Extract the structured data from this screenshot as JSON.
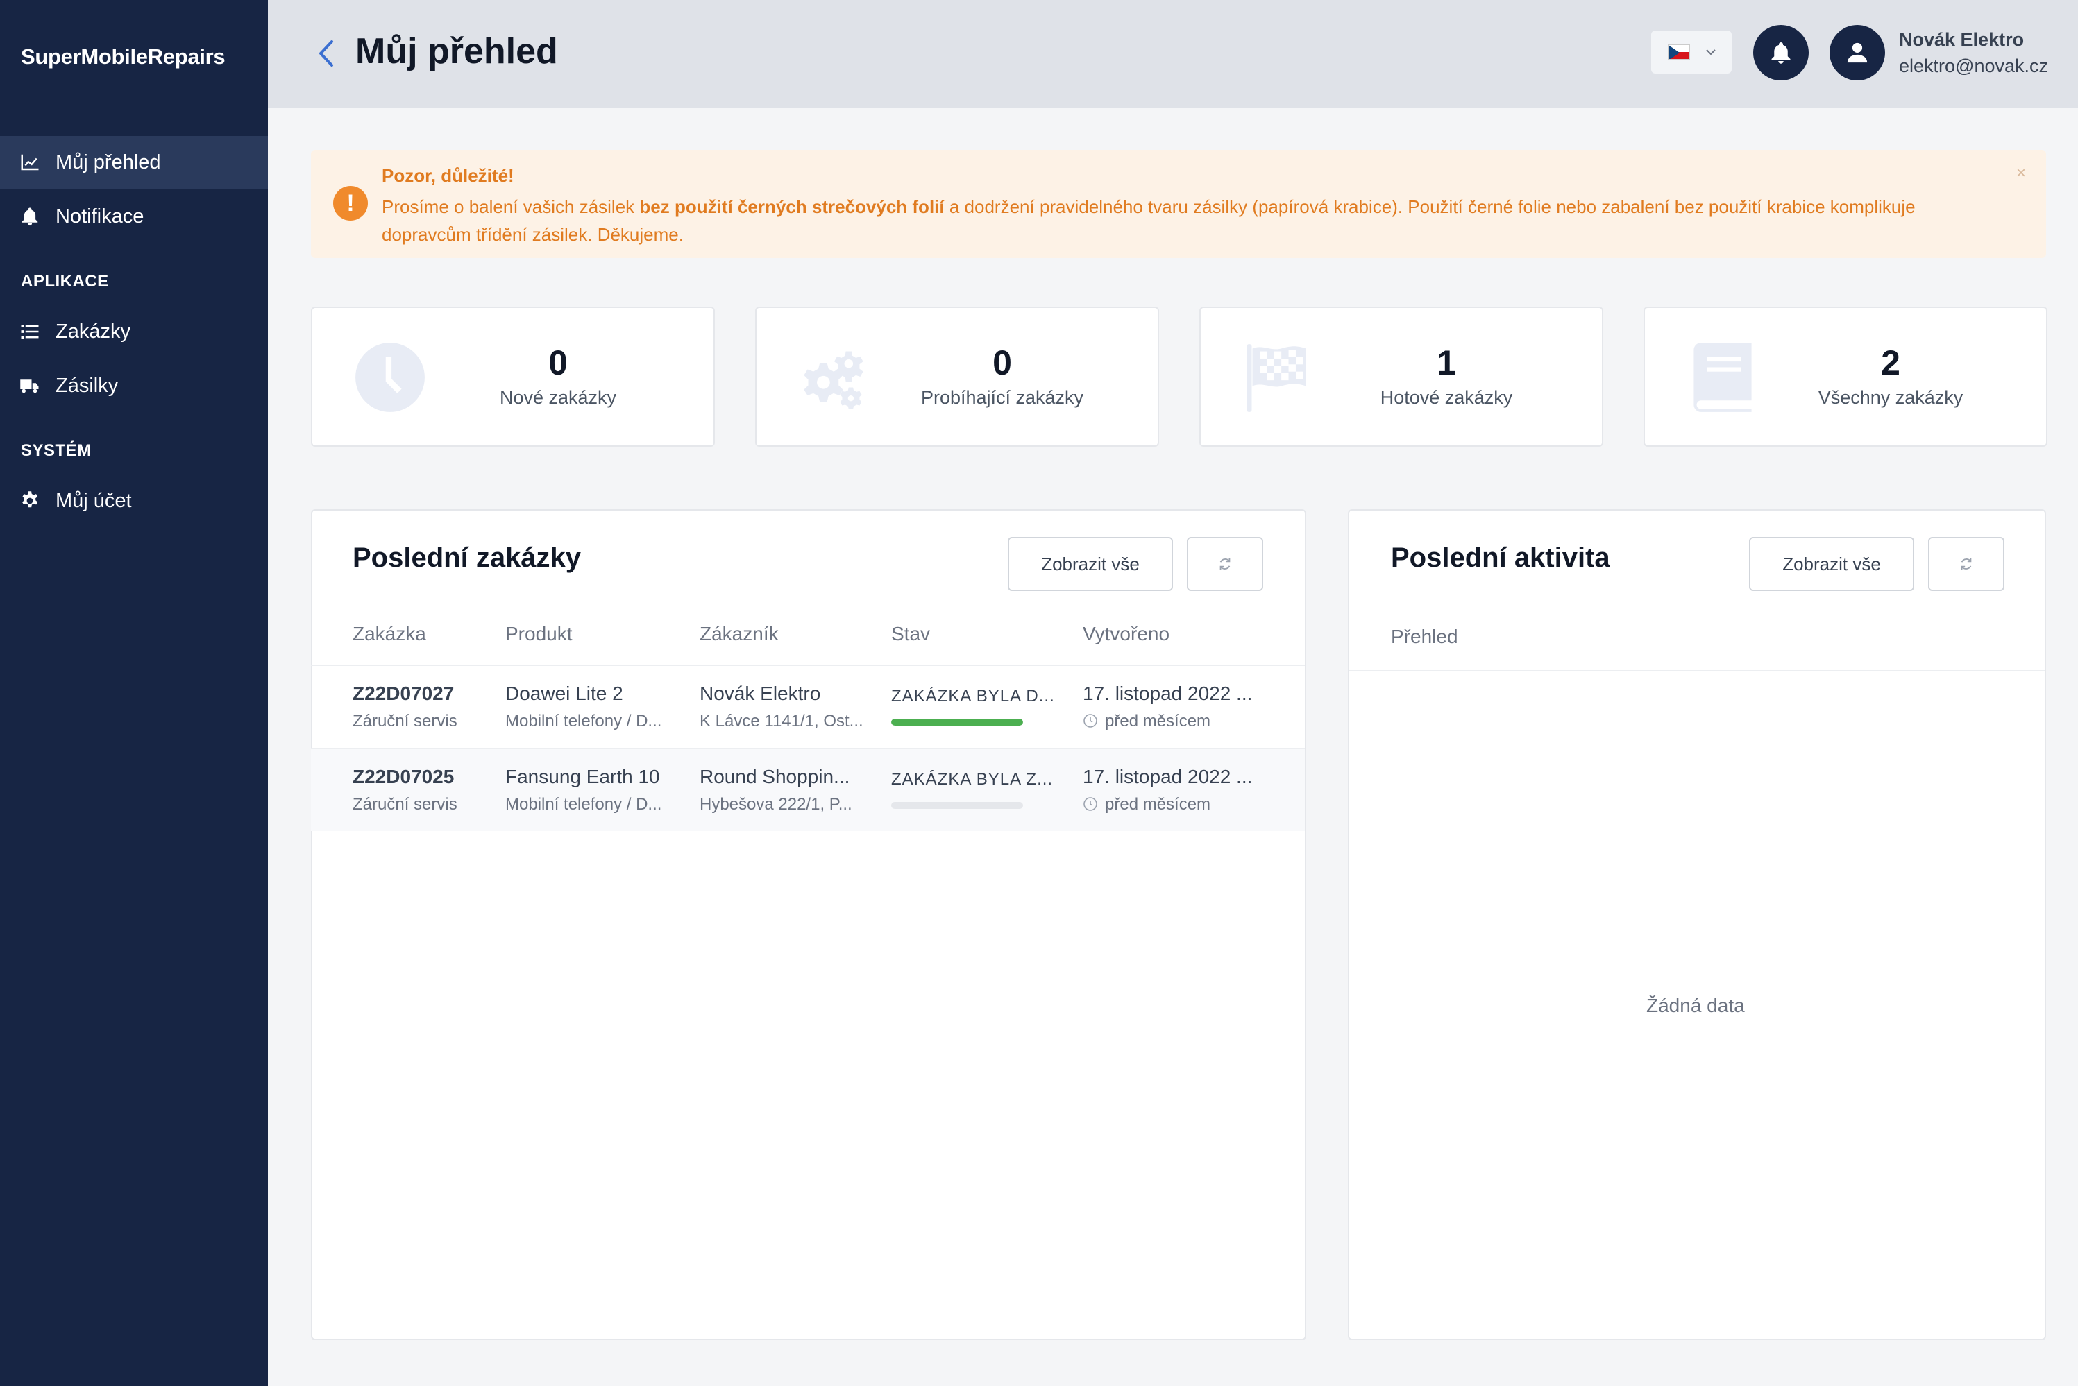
{
  "brand": "SuperMobileRepairs",
  "sidebar": {
    "items": [
      {
        "label": "Můj přehled",
        "icon": "chart-line-icon"
      },
      {
        "label": "Notifikace",
        "icon": "bell-icon"
      }
    ],
    "sections": [
      {
        "title": "APLIKACE",
        "items": [
          {
            "label": "Zakázky",
            "icon": "list-icon"
          },
          {
            "label": "Zásilky",
            "icon": "truck-icon"
          }
        ]
      },
      {
        "title": "SYSTÉM",
        "items": [
          {
            "label": "Můj účet",
            "icon": "gear-icon"
          }
        ]
      }
    ]
  },
  "header": {
    "title": "Můj přehled",
    "language": "cz-flag-icon",
    "user": {
      "name": "Novák Elektro",
      "email": "elektro@novak.cz"
    }
  },
  "alert": {
    "title": "Pozor, důležité!",
    "text_before": "Prosíme o balení vašich zásilek ",
    "text_bold": "bez použití černých strečových folií",
    "text_after": " a dodržení pravidelného tvaru zásilky (papírová krabice). Použití černé folie nebo zabalení bez použití krabice komplikuje dopravcům třídění zásilek. Děkujeme.",
    "close": "×"
  },
  "stats": [
    {
      "value": "0",
      "label": "Nové zakázky",
      "icon": "clock-icon"
    },
    {
      "value": "0",
      "label": "Probíhající zakázky",
      "icon": "gears-icon"
    },
    {
      "value": "1",
      "label": "Hotové zakázky",
      "icon": "checkered-flag-icon"
    },
    {
      "value": "2",
      "label": "Všechny zakázky",
      "icon": "book-icon"
    }
  ],
  "orders": {
    "title": "Poslední zakázky",
    "show_all": "Zobrazit vše",
    "columns": [
      "Zakázka",
      "Produkt",
      "Zákazník",
      "Stav",
      "Vytvořeno"
    ],
    "rows": [
      {
        "id": "Z22D07027",
        "type": "Záruční servis",
        "product": "Doawei Lite 2",
        "category": "Mobilní telefony / D...",
        "customer": "Novák Elektro",
        "address": "K Lávce 1141/1, Ost...",
        "status": "ZAKÁZKA BYLA D...",
        "progress": 1.0,
        "created": "17. listopad 2022 ...",
        "ago": "před měsícem"
      },
      {
        "id": "Z22D07025",
        "type": "Záruční servis",
        "product": "Fansung Earth 10",
        "category": "Mobilní telefony / D...",
        "customer": "Round Shoppin...",
        "address": "Hybešova 222/1, P...",
        "status": "ZAKÁZKA BYLA Z...",
        "progress": 0.0,
        "created": "17. listopad 2022 ...",
        "ago": "před měsícem"
      }
    ]
  },
  "activity": {
    "title": "Poslední aktivita",
    "show_all": "Zobrazit vše",
    "column": "Přehled",
    "empty": "Žádná data"
  },
  "colors": {
    "sidebar": "#172544",
    "accent_orange": "#e07b20",
    "progress_green": "#4caf50"
  }
}
